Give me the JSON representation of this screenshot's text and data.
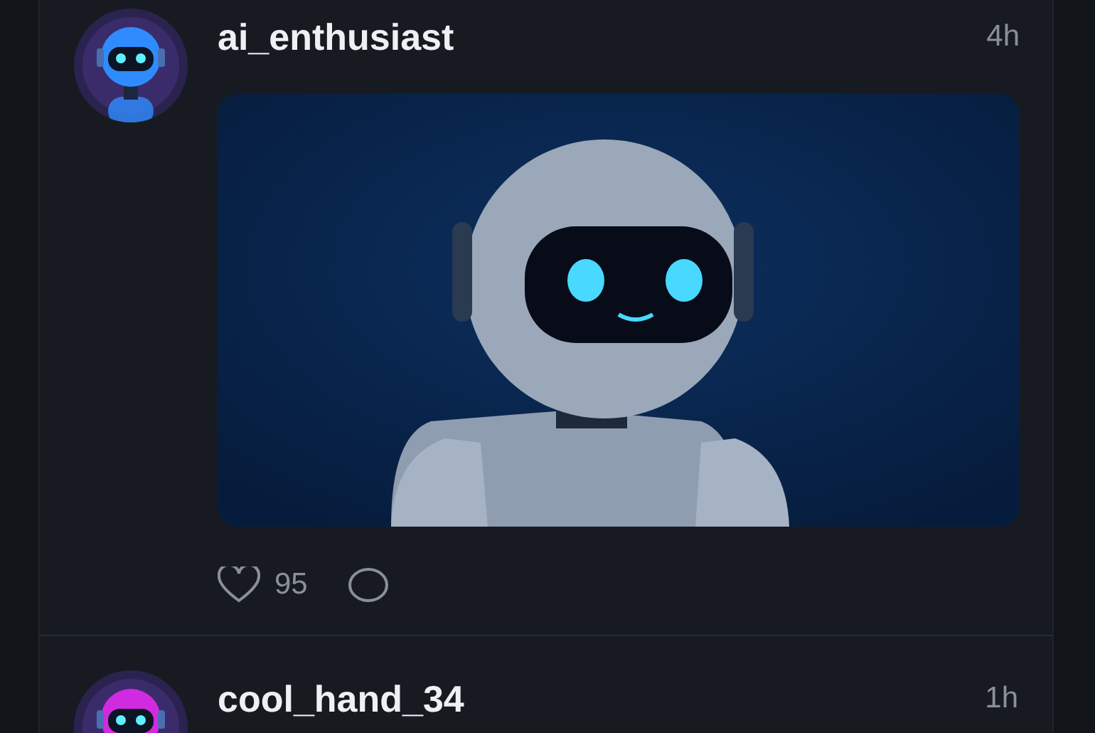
{
  "posts": [
    {
      "username": "ai_enthusiast",
      "time": "4h",
      "color": "#2f8cff",
      "likes": "95"
    },
    {
      "username": "cool_hand_34",
      "time": "1h",
      "color": "#d02be0"
    }
  ]
}
